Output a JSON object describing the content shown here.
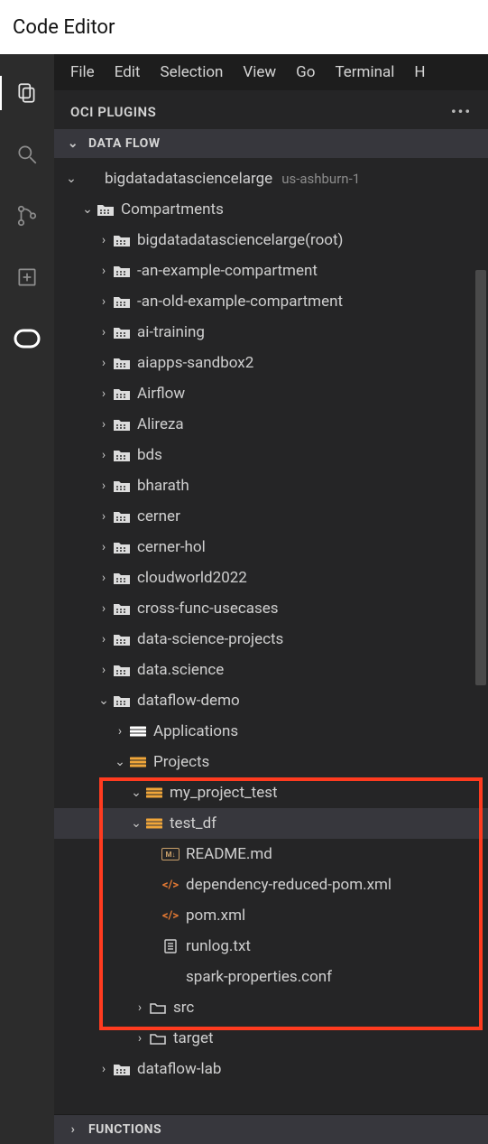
{
  "app_title": "Code Editor",
  "menu": {
    "items": [
      "File",
      "Edit",
      "Selection",
      "View",
      "Go",
      "Terminal",
      "H"
    ]
  },
  "panel": {
    "title": "OCI PLUGINS"
  },
  "sections": {
    "dataflow": {
      "label": "DATA FLOW",
      "expanded": true
    },
    "functions": {
      "label": "FUNCTIONS",
      "expanded": false
    }
  },
  "tenancy": {
    "name": "bigdatadatasciencelarge",
    "region": "us-ashburn-1"
  },
  "compartments_label": "Compartments",
  "compartments": [
    {
      "name": "bigdatadatasciencelarge(root)"
    },
    {
      "name": "-an-example-compartment"
    },
    {
      "name": "-an-old-example-compartment"
    },
    {
      "name": "ai-training"
    },
    {
      "name": "aiapps-sandbox2"
    },
    {
      "name": "Airflow"
    },
    {
      "name": "Alireza"
    },
    {
      "name": "bds"
    },
    {
      "name": "bharath"
    },
    {
      "name": "cerner"
    },
    {
      "name": "cerner-hol"
    },
    {
      "name": "cloudworld2022"
    },
    {
      "name": "cross-func-usecases"
    },
    {
      "name": "data-science-projects"
    },
    {
      "name": "data.science"
    }
  ],
  "dataflow_demo": {
    "name": "dataflow-demo",
    "applications_label": "Applications",
    "projects_label": "Projects",
    "projects": [
      {
        "name": "my_project_test"
      },
      {
        "name": "test_df",
        "files": [
          {
            "name": "README.md",
            "kind": "md"
          },
          {
            "name": "dependency-reduced-pom.xml",
            "kind": "code"
          },
          {
            "name": "pom.xml",
            "kind": "code"
          },
          {
            "name": "runlog.txt",
            "kind": "txt"
          },
          {
            "name": "spark-properties.conf",
            "kind": "plain"
          }
        ],
        "folders": [
          {
            "name": "src"
          },
          {
            "name": "target"
          }
        ]
      }
    ]
  },
  "dataflow_lab": {
    "name": "dataflow-lab"
  }
}
